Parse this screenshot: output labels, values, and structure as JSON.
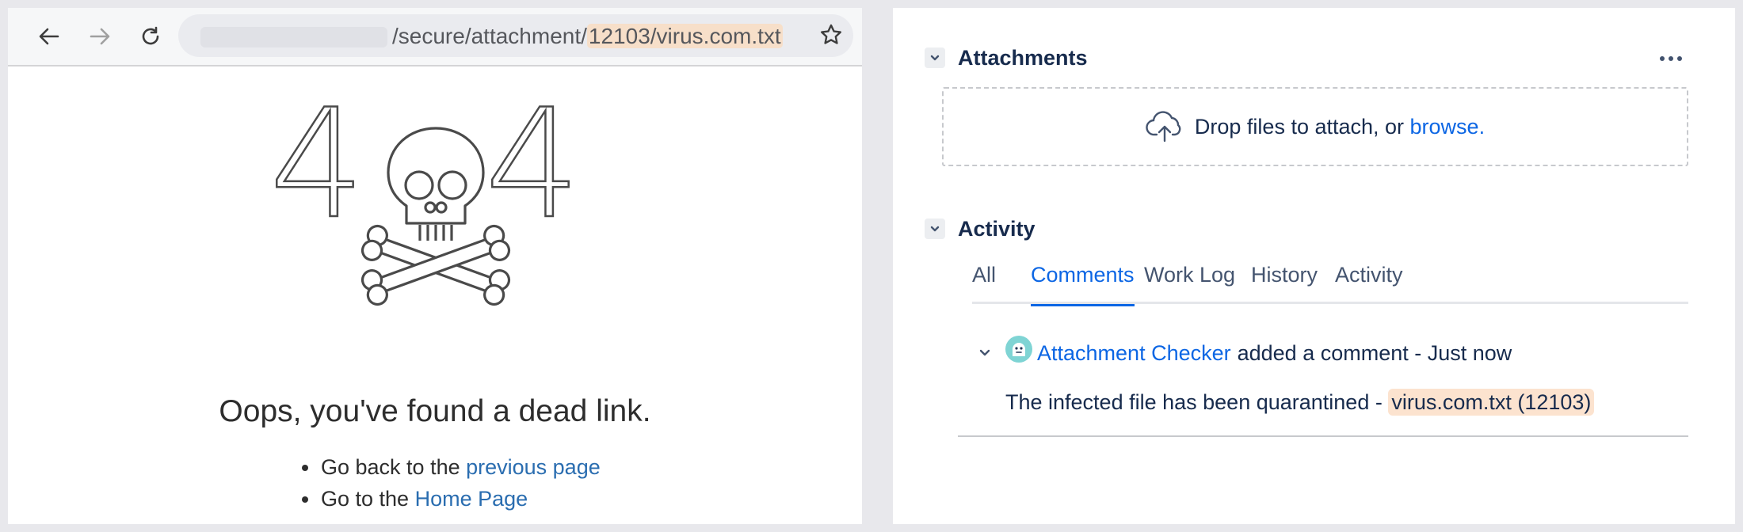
{
  "browser": {
    "url_path": "/secure/attachment/",
    "url_highlight": "12103/virus.com.txt"
  },
  "error_page": {
    "digit_left": "4",
    "digit_right": "4",
    "title": "Oops, you've found a dead link.",
    "links": [
      {
        "prefix": "Go back to the ",
        "link": "previous page"
      },
      {
        "prefix": "Go to the ",
        "link": "Home Page"
      }
    ]
  },
  "attachments": {
    "title": "Attachments",
    "drop_text": "Drop files to attach, or ",
    "browse_label": "browse."
  },
  "activity": {
    "title": "Activity",
    "tabs": [
      "All",
      "Comments",
      "Work Log",
      "History",
      "Activity"
    ],
    "active_tab": "Comments",
    "comment": {
      "author": "Attachment Checker",
      "action": "added a comment - Just now",
      "body_prefix": "The infected file has been quarantined - ",
      "body_highlight": "virus.com.txt (12103)"
    }
  },
  "colors": {
    "link": "#2a6db0",
    "jira_blue": "#0c66e4",
    "highlight": "#f7dfc9"
  }
}
